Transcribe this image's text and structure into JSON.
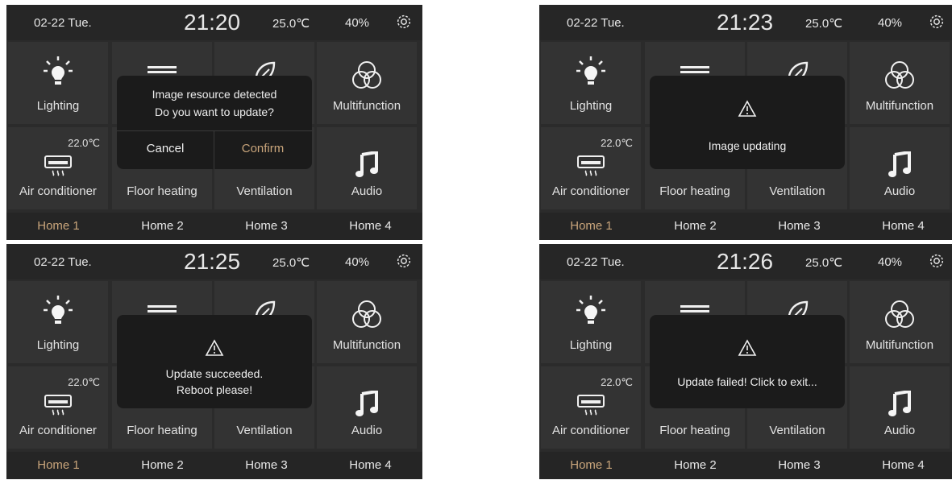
{
  "panels": [
    {
      "status": {
        "date": "02-22  Tue.",
        "time": "21:20",
        "temp": "25.0℃",
        "humidity": "40%"
      },
      "tiles": {
        "lighting": "Lighting",
        "multifunction": "Multifunction",
        "air_conditioner": "Air conditioner",
        "air_setpoint": "22.0℃",
        "floor_heating": "Floor heating",
        "ventilation": "Ventilation",
        "audio": "Audio"
      },
      "tabs": [
        "Home 1",
        "Home 2",
        "Home 3",
        "Home 4"
      ],
      "dialog": {
        "line1": "Image resource detected",
        "line2": "Do you want to update?",
        "cancel": "Cancel",
        "confirm": "Confirm"
      }
    },
    {
      "status": {
        "date": "02-22  Tue.",
        "time": "21:23",
        "temp": "25.0℃",
        "humidity": "40%"
      },
      "tiles": {
        "lighting": "Lighting",
        "multifunction": "Multifunction",
        "air_conditioner": "Air conditioner",
        "air_setpoint": "22.0℃",
        "floor_heating": "Floor heating",
        "ventilation": "Ventilation",
        "audio": "Audio"
      },
      "tabs": [
        "Home 1",
        "Home 2",
        "Home 3",
        "Home 4"
      ],
      "dialog": {
        "line1": "Image updating",
        "line2": ""
      }
    },
    {
      "status": {
        "date": "02-22  Tue.",
        "time": "21:25",
        "temp": "25.0℃",
        "humidity": "40%"
      },
      "tiles": {
        "lighting": "Lighting",
        "multifunction": "Multifunction",
        "air_conditioner": "Air conditioner",
        "air_setpoint": "22.0℃",
        "floor_heating": "Floor heating",
        "ventilation": "Ventilation",
        "audio": "Audio"
      },
      "tabs": [
        "Home 1",
        "Home 2",
        "Home 3",
        "Home 4"
      ],
      "dialog": {
        "line1": "Update succeeded.",
        "line2": "Reboot please!"
      }
    },
    {
      "status": {
        "date": "02-22  Tue.",
        "time": "21:26",
        "temp": "25.0℃",
        "humidity": "40%"
      },
      "tiles": {
        "lighting": "Lighting",
        "multifunction": "Multifunction",
        "air_conditioner": "Air conditioner",
        "air_setpoint": "22.0℃",
        "floor_heating": "Floor heating",
        "ventilation": "Ventilation",
        "audio": "Audio"
      },
      "tabs": [
        "Home 1",
        "Home 2",
        "Home 3",
        "Home 4"
      ],
      "dialog": {
        "line1": "Update failed!  Click to exit...",
        "line2": ""
      }
    }
  ],
  "icons": {
    "lighting": "bulb-icon",
    "floor_heating": "floor-heating-icon",
    "ventilation": "leaf-icon",
    "multifunction": "rgb-circles-icon",
    "air_conditioner": "air-conditioner-icon",
    "audio": "music-note-icon",
    "settings": "gear-icon",
    "warning": "warning-triangle-icon"
  },
  "colors": {
    "accent": "#c9a57b",
    "background": "#2b2b2b",
    "tile": "#333333",
    "dialog": "#1b1b1b"
  }
}
